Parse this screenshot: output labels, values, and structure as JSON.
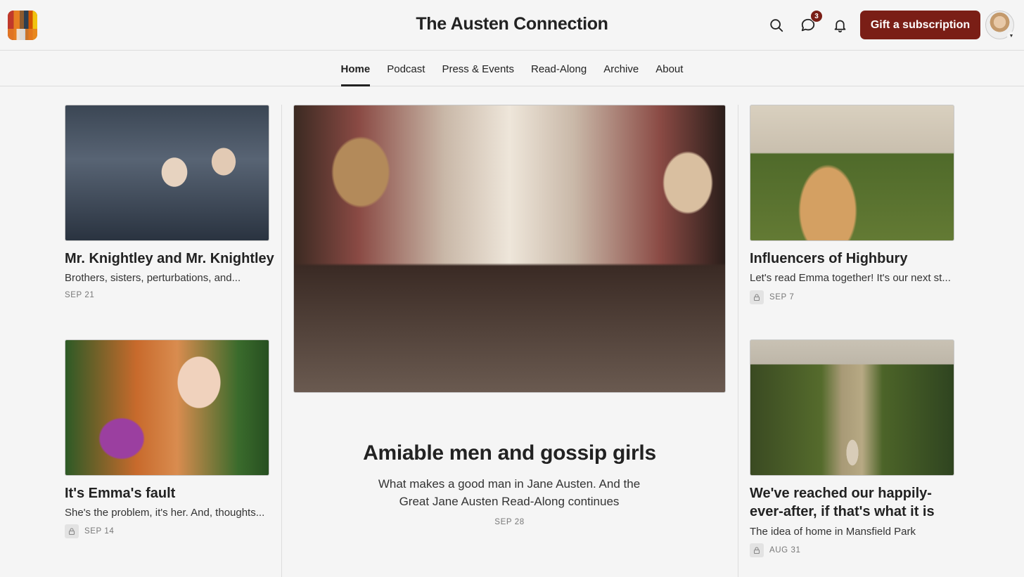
{
  "header": {
    "site_title": "The Austen Connection",
    "message_count": "3",
    "gift_label": "Gift a subscription",
    "accent_color": "#7a1e16"
  },
  "nav": {
    "items": [
      {
        "label": "Home",
        "active": true
      },
      {
        "label": "Podcast"
      },
      {
        "label": "Press & Events"
      },
      {
        "label": "Read-Along"
      },
      {
        "label": "Archive"
      },
      {
        "label": "About"
      }
    ]
  },
  "posts": {
    "left": [
      {
        "title": "Mr. Knightley and Mr. Knightley",
        "subtitle": "Brothers, sisters, perturbations, and...",
        "date": "SEP 21",
        "locked": false
      },
      {
        "title": "It's Emma's fault",
        "subtitle": "She's the problem, it's her. And, thoughts...",
        "date": "SEP 14",
        "locked": true
      }
    ],
    "feature": {
      "title": "Amiable men and gossip girls",
      "subtitle": "What makes a good man in Jane Austen. And the Great Jane Austen Read-Along continues",
      "date": "SEP 28"
    },
    "right": [
      {
        "title": "Influencers of Highbury",
        "subtitle": "Let's read Emma together! It's our next st...",
        "date": "SEP 7",
        "locked": true
      },
      {
        "title": "We've reached our happily-ever-after, if that's what it is",
        "subtitle": "The idea of home in Mansfield Park",
        "date": "AUG 31",
        "locked": true
      }
    ]
  },
  "icons": [
    "search-icon",
    "message-icon",
    "bell-icon",
    "lock-icon",
    "chevron-down-icon"
  ]
}
